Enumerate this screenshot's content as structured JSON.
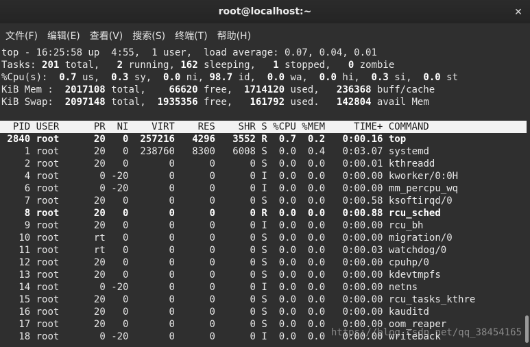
{
  "window": {
    "title": "root@localhost:~",
    "close_glyph": "✕"
  },
  "menu": [
    {
      "label": "文件(F)"
    },
    {
      "label": "编辑(E)"
    },
    {
      "label": "查看(V)"
    },
    {
      "label": "搜索(S)"
    },
    {
      "label": "终端(T)"
    },
    {
      "label": "帮助(H)"
    }
  ],
  "summary": {
    "top_line": "top - 16:25:58 up  4:55,  1 user,  load average: 0.07, 0.04, 0.01",
    "tasks": {
      "lbl": "Tasks: ",
      "total": "201",
      "t1": " total,   ",
      "running": "2",
      "t2": " running, ",
      "sleeping": "162",
      "t3": " sleeping,   ",
      "stopped": "1",
      "t4": " stopped,   ",
      "zombie": "0",
      "t5": " zombie"
    },
    "cpu": {
      "lbl": "%Cpu(s):  ",
      "us": "0.7",
      "t1": " us,  ",
      "sy": "0.3",
      "t2": " sy,  ",
      "ni": "0.0",
      "t3": " ni, ",
      "id": "98.7",
      "t4": " id,  ",
      "wa": "0.0",
      "t5": " wa,  ",
      "hi": "0.0",
      "t6": " hi,  ",
      "si": "0.3",
      "t7": " si,  ",
      "st": "0.0",
      "t8": " st"
    },
    "mem": {
      "lbl": "KiB Mem :  ",
      "total": "2017108",
      "t1": " total,    ",
      "free": "66620",
      "t2": " free,  ",
      "used": "1714120",
      "t3": " used,   ",
      "buff": "236368",
      "t4": " buff/cache"
    },
    "swap": {
      "lbl": "KiB Swap:  ",
      "total": "2097148",
      "t1": " total,  ",
      "free": "1935356",
      "t2": " free,   ",
      "used": "161792",
      "t3": " used.   ",
      "avail": "142804",
      "t4": " avail Mem"
    }
  },
  "table": {
    "header": "  PID USER      PR  NI    VIRT    RES    SHR S %CPU %MEM     TIME+ COMMAND",
    "rows": [
      {
        "pid": "2840",
        "user": "root",
        "pr": "20",
        "ni": "0",
        "virt": "257216",
        "res": "4296",
        "shr": "3552",
        "s": "R",
        "cpu": "0.7",
        "mem": "0.2",
        "time": "0:00.16",
        "cmd": "top",
        "bold": true
      },
      {
        "pid": "1",
        "user": "root",
        "pr": "20",
        "ni": "0",
        "virt": "238760",
        "res": "8300",
        "shr": "6008",
        "s": "S",
        "cpu": "0.0",
        "mem": "0.4",
        "time": "0:03.07",
        "cmd": "systemd"
      },
      {
        "pid": "2",
        "user": "root",
        "pr": "20",
        "ni": "0",
        "virt": "0",
        "res": "0",
        "shr": "0",
        "s": "S",
        "cpu": "0.0",
        "mem": "0.0",
        "time": "0:00.01",
        "cmd": "kthreadd"
      },
      {
        "pid": "4",
        "user": "root",
        "pr": "0",
        "ni": "-20",
        "virt": "0",
        "res": "0",
        "shr": "0",
        "s": "I",
        "cpu": "0.0",
        "mem": "0.0",
        "time": "0:00.00",
        "cmd": "kworker/0:0H"
      },
      {
        "pid": "6",
        "user": "root",
        "pr": "0",
        "ni": "-20",
        "virt": "0",
        "res": "0",
        "shr": "0",
        "s": "I",
        "cpu": "0.0",
        "mem": "0.0",
        "time": "0:00.00",
        "cmd": "mm_percpu_wq"
      },
      {
        "pid": "7",
        "user": "root",
        "pr": "20",
        "ni": "0",
        "virt": "0",
        "res": "0",
        "shr": "0",
        "s": "S",
        "cpu": "0.0",
        "mem": "0.0",
        "time": "0:00.58",
        "cmd": "ksoftirqd/0"
      },
      {
        "pid": "8",
        "user": "root",
        "pr": "20",
        "ni": "0",
        "virt": "0",
        "res": "0",
        "shr": "0",
        "s": "R",
        "cpu": "0.0",
        "mem": "0.0",
        "time": "0:00.88",
        "cmd": "rcu_sched",
        "bold": true
      },
      {
        "pid": "9",
        "user": "root",
        "pr": "20",
        "ni": "0",
        "virt": "0",
        "res": "0",
        "shr": "0",
        "s": "I",
        "cpu": "0.0",
        "mem": "0.0",
        "time": "0:00.00",
        "cmd": "rcu_bh"
      },
      {
        "pid": "10",
        "user": "root",
        "pr": "rt",
        "ni": "0",
        "virt": "0",
        "res": "0",
        "shr": "0",
        "s": "S",
        "cpu": "0.0",
        "mem": "0.0",
        "time": "0:00.00",
        "cmd": "migration/0"
      },
      {
        "pid": "11",
        "user": "root",
        "pr": "rt",
        "ni": "0",
        "virt": "0",
        "res": "0",
        "shr": "0",
        "s": "S",
        "cpu": "0.0",
        "mem": "0.0",
        "time": "0:00.03",
        "cmd": "watchdog/0"
      },
      {
        "pid": "12",
        "user": "root",
        "pr": "20",
        "ni": "0",
        "virt": "0",
        "res": "0",
        "shr": "0",
        "s": "S",
        "cpu": "0.0",
        "mem": "0.0",
        "time": "0:00.00",
        "cmd": "cpuhp/0"
      },
      {
        "pid": "13",
        "user": "root",
        "pr": "20",
        "ni": "0",
        "virt": "0",
        "res": "0",
        "shr": "0",
        "s": "S",
        "cpu": "0.0",
        "mem": "0.0",
        "time": "0:00.00",
        "cmd": "kdevtmpfs"
      },
      {
        "pid": "14",
        "user": "root",
        "pr": "0",
        "ni": "-20",
        "virt": "0",
        "res": "0",
        "shr": "0",
        "s": "I",
        "cpu": "0.0",
        "mem": "0.0",
        "time": "0:00.00",
        "cmd": "netns"
      },
      {
        "pid": "15",
        "user": "root",
        "pr": "20",
        "ni": "0",
        "virt": "0",
        "res": "0",
        "shr": "0",
        "s": "S",
        "cpu": "0.0",
        "mem": "0.0",
        "time": "0:00.00",
        "cmd": "rcu_tasks_kthre"
      },
      {
        "pid": "16",
        "user": "root",
        "pr": "20",
        "ni": "0",
        "virt": "0",
        "res": "0",
        "shr": "0",
        "s": "S",
        "cpu": "0.0",
        "mem": "0.0",
        "time": "0:00.00",
        "cmd": "kauditd"
      },
      {
        "pid": "17",
        "user": "root",
        "pr": "20",
        "ni": "0",
        "virt": "0",
        "res": "0",
        "shr": "0",
        "s": "S",
        "cpu": "0.0",
        "mem": "0.0",
        "time": "0:00.00",
        "cmd": "oom_reaper"
      },
      {
        "pid": "18",
        "user": "root",
        "pr": "0",
        "ni": "-20",
        "virt": "0",
        "res": "0",
        "shr": "0",
        "s": "I",
        "cpu": "0.0",
        "mem": "0.0",
        "time": "0:00.00",
        "cmd": "writeback"
      }
    ]
  },
  "watermark": "https://blog.csdn.net/qq_38454165",
  "colors": {
    "background": "#2f2f2f",
    "text": "#e7e7e7",
    "header_bg": "#f2f2f2",
    "titlebar": "#262626"
  }
}
